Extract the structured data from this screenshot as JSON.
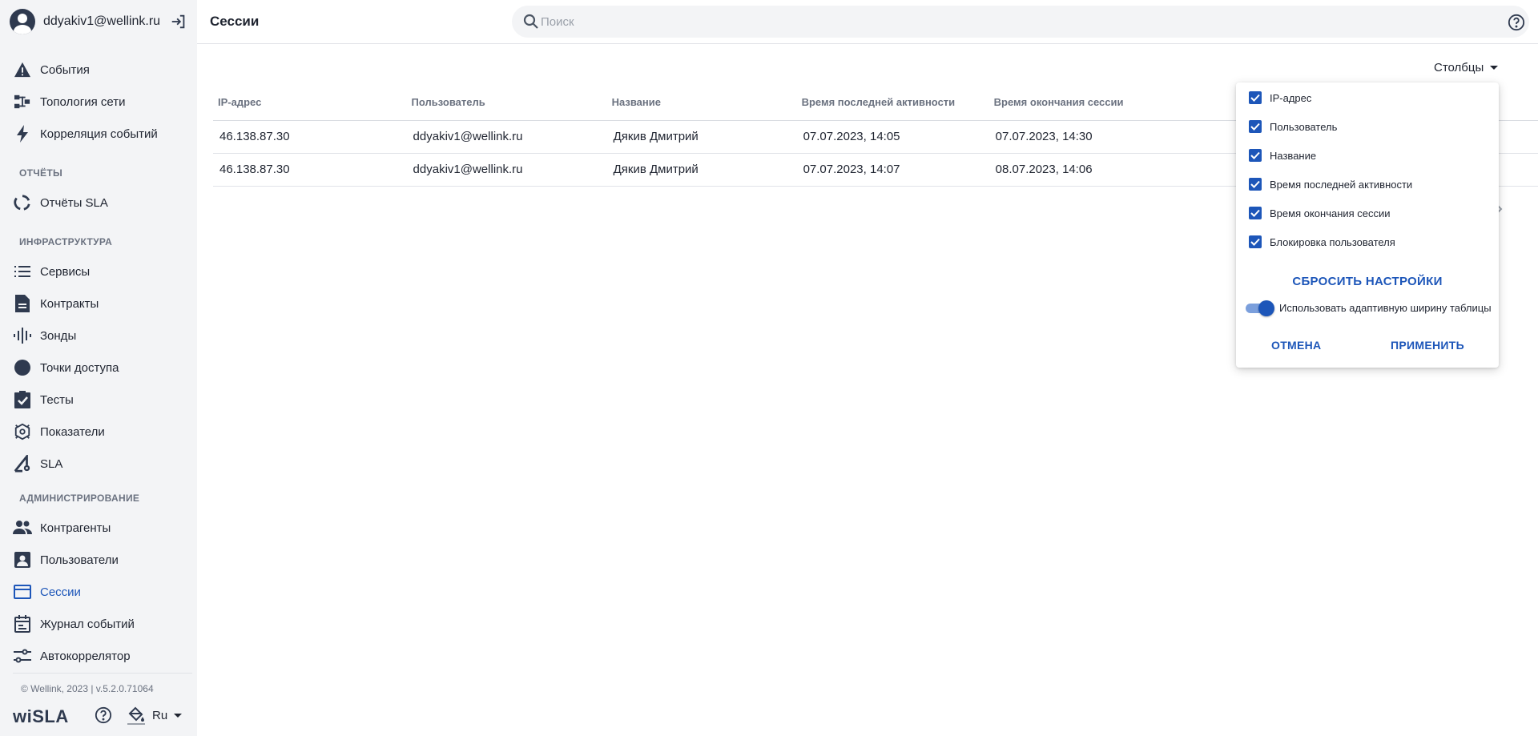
{
  "sidebar": {
    "user": "ddyakiv1@wellink.ru",
    "items": [
      {
        "icon": "warning-icon",
        "label": "События"
      },
      {
        "icon": "topology-icon",
        "label": "Топология сети"
      },
      {
        "icon": "lightning-icon",
        "label": "Корреляция событий"
      }
    ],
    "sections": {
      "reports": "ОТЧЁТЫ",
      "infrastructure": "ИНФРАСТРУКТУРА",
      "admin": "АДМИНИСТРИРОВАНИЕ"
    },
    "reports_items": [
      {
        "icon": "sla-report-icon",
        "label": "Отчёты SLA"
      }
    ],
    "infra_items": [
      {
        "icon": "list-icon",
        "label": "Сервисы"
      },
      {
        "icon": "document-icon",
        "label": "Контракты"
      },
      {
        "icon": "probe-icon",
        "label": "Зонды"
      },
      {
        "icon": "circle-icon",
        "label": "Точки доступа"
      },
      {
        "icon": "clipboard-check-icon",
        "label": "Тесты"
      },
      {
        "icon": "metrics-icon",
        "label": "Показатели"
      },
      {
        "icon": "sla-icon",
        "label": "SLA"
      }
    ],
    "admin_items": [
      {
        "icon": "people-icon",
        "label": "Контрагенты"
      },
      {
        "icon": "user-card-icon",
        "label": "Пользователи"
      },
      {
        "icon": "browser-window-icon",
        "label": "Сессии",
        "active": true
      },
      {
        "icon": "calendar-icon",
        "label": "Журнал событий"
      },
      {
        "icon": "sliders-icon",
        "label": "Автокоррелятор"
      }
    ],
    "copyright": "© Wellink, 2023 | v.5.2.0.71064",
    "brand": "wiSLA",
    "language": "Ru"
  },
  "topbar": {
    "title": "Сессии",
    "search_placeholder": "Поиск"
  },
  "content": {
    "columns_button": "Столбцы",
    "table": {
      "headers": [
        "IP-адрес",
        "Пользователь",
        "Название",
        "Время последней активности",
        "Время окончания сессии"
      ],
      "rows": [
        [
          "46.138.87.30",
          "ddyakiv1@wellink.ru",
          "Дякив Дмитрий",
          "07.07.2023, 14:05",
          "07.07.2023, 14:30"
        ],
        [
          "46.138.87.30",
          "ddyakiv1@wellink.ru",
          "Дякив Дмитрий",
          "07.07.2023, 14:07",
          "08.07.2023, 14:06"
        ]
      ]
    }
  },
  "popover": {
    "options": [
      {
        "label": "IP-адрес",
        "checked": true
      },
      {
        "label": "Пользователь",
        "checked": true
      },
      {
        "label": "Название",
        "checked": true
      },
      {
        "label": "Время последней активности",
        "checked": true
      },
      {
        "label": "Время окончания сессии",
        "checked": true
      },
      {
        "label": "Блокировка пользователя",
        "checked": true
      }
    ],
    "reset": "СБРОСИТЬ НАСТРОЙКИ",
    "adaptive_label": "Использовать адаптивную ширину таблицы",
    "adaptive_on": true,
    "cancel": "ОТМЕНА",
    "apply": "ПРИМЕНИТЬ"
  },
  "colors": {
    "accent": "#1d56b9",
    "sidebar_bg": "#f3f4f6",
    "text": "#1f2430",
    "muted": "#6b7280"
  }
}
